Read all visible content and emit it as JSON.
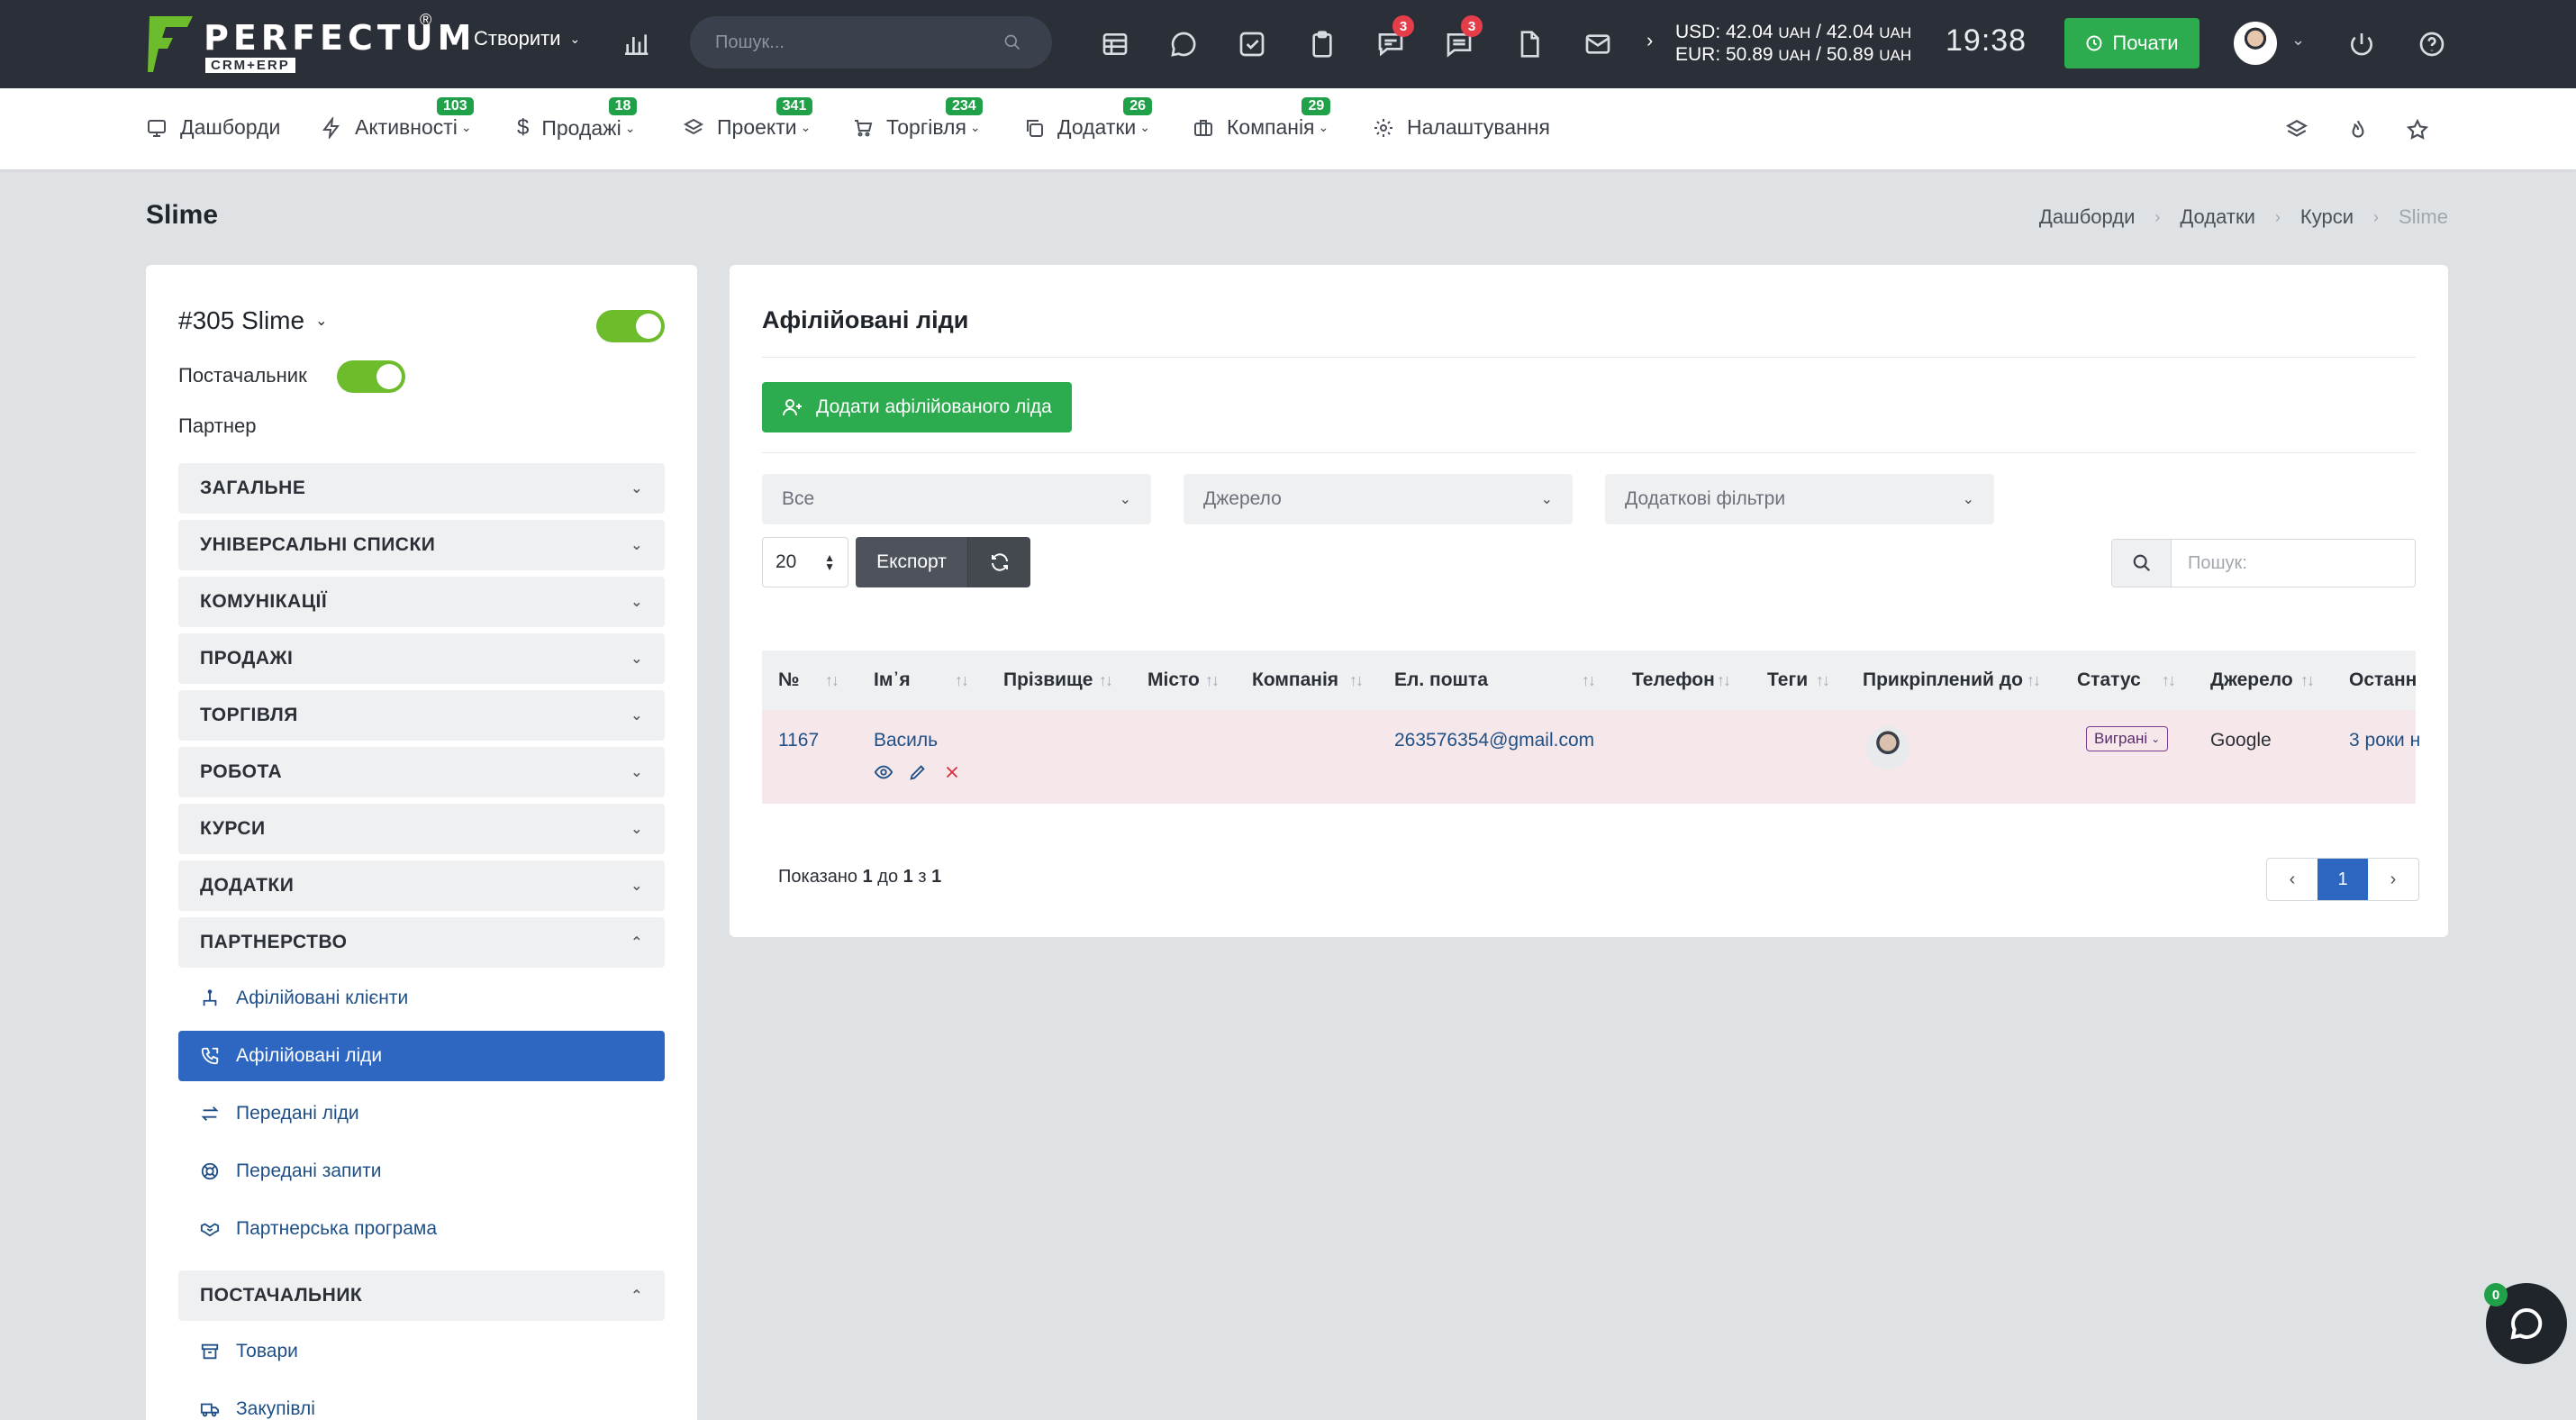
{
  "brand": {
    "name": "PERFECTUM",
    "reg": "®",
    "sub": "CRM+ERP",
    "accent": "#6cbc2c"
  },
  "topbar": {
    "create_label": "Створити",
    "search_placeholder": "Пошук...",
    "badges": {
      "chat": "3",
      "messages": "3"
    },
    "rates": {
      "usd_prefix": "USD: 42.04",
      "usd_mid": " / 42.04",
      "eur_prefix": "EUR: 50.89",
      "eur_mid": " / 50.89",
      "unit": "UAH"
    },
    "time": "19:38",
    "start_label": "Почати"
  },
  "nav": {
    "items": [
      {
        "label": "Дашборди",
        "badge": ""
      },
      {
        "label": "Активності",
        "badge": "103"
      },
      {
        "label": "Продажі",
        "badge": "18"
      },
      {
        "label": "Проекти",
        "badge": "341"
      },
      {
        "label": "Торгівля",
        "badge": "234"
      },
      {
        "label": "Додатки",
        "badge": "26"
      },
      {
        "label": "Компанія",
        "badge": "29"
      },
      {
        "label": "Налаштування",
        "badge": ""
      }
    ]
  },
  "page": {
    "title": "Slime",
    "breadcrumb": [
      "Дашборди",
      "Додатки",
      "Курси",
      "Slime"
    ]
  },
  "left": {
    "entity_title": "#305 Slime",
    "supplier_label": "Постачальник",
    "partner_label": "Партнер",
    "sections": [
      "ЗАГАЛЬНЕ",
      "УНІВЕРСАЛЬНІ СПИСКИ",
      "КОМУНІКАЦІЇ",
      "ПРОДАЖІ",
      "ТОРГІВЛЯ",
      "РОБОТА",
      "КУРСИ",
      "ДОДАТКИ",
      "ПАРТНЕРСТВО"
    ],
    "partnership_items": [
      "Афілійовані клієнти",
      "Афілійовані ліди",
      "Передані ліди",
      "Передані запити",
      "Партнерська програма"
    ],
    "supplier_section": "ПОСТАЧАЛЬНИК",
    "supplier_items": [
      "Товари",
      "Закупівлі"
    ]
  },
  "main": {
    "title": "Афілійовані ліди",
    "add_button": "Додати афілійованого ліда",
    "filters": [
      "Все",
      "Джерело",
      "Додаткові фільтри"
    ],
    "per_page": "20",
    "export_label": "Експорт",
    "search_placeholder": "Пошук:",
    "columns": [
      "№",
      "Ім᾽я",
      "Прізвище",
      "Місто",
      "Компанія",
      "Ел. пошта",
      "Телефон",
      "Теги",
      "Прикріплений до",
      "Статус",
      "Джерело",
      "Останн"
    ],
    "rows": [
      {
        "id": "1167",
        "name": "Василь",
        "surname": "",
        "city": "",
        "company": "",
        "email": "263576354@gmail.com",
        "phone": "",
        "tags": "",
        "status": "Виграні",
        "source": "Google",
        "last": "3 роки н"
      }
    ],
    "shown_prefix": "Показано ",
    "shown_from": "1",
    "shown_to_word": " до ",
    "shown_to": "1",
    "shown_of_word": " з ",
    "shown_total": "1",
    "current_page": "1"
  },
  "chat_badge": "0"
}
